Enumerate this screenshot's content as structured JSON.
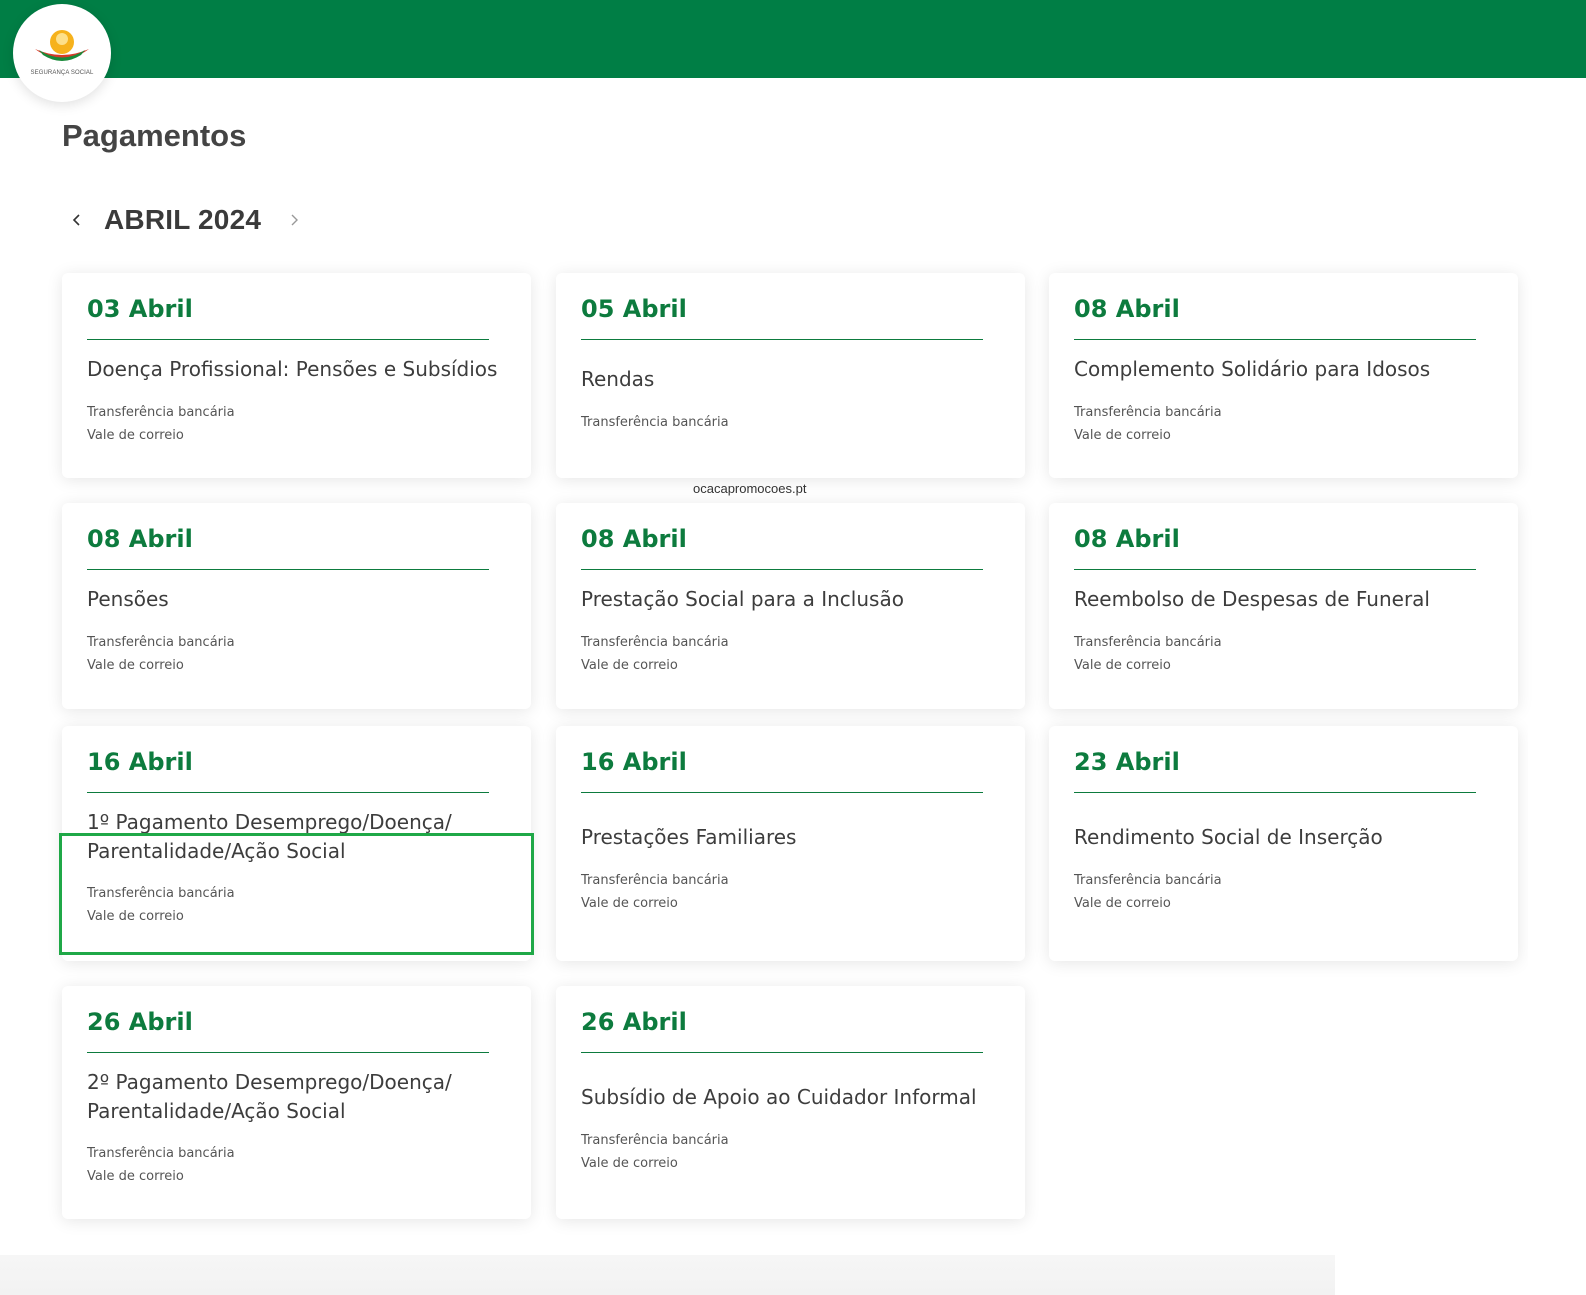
{
  "header": {
    "logo_text": "SEGURANÇA SOCIAL",
    "brand_color": "#007e45"
  },
  "page": {
    "title": "Pagamentos"
  },
  "month_nav": {
    "label": "ABRIL 2024",
    "prev_icon": "chevron-left-icon",
    "next_icon": "chevron-right-icon"
  },
  "watermark": "ocacapromocoes.pt",
  "payments": [
    {
      "date": "03 Abril",
      "title": "Doença Profissional: Pensões e Subsídios",
      "methods": [
        "Transferência bancária",
        "Vale de correio"
      ]
    },
    {
      "date": "05 Abril",
      "title": "Rendas",
      "methods": [
        "Transferência bancária"
      ]
    },
    {
      "date": "08 Abril",
      "title": "Complemento Solidário para Idosos",
      "methods": [
        "Transferência bancária",
        "Vale de correio"
      ]
    },
    {
      "date": "08 Abril",
      "title": "Pensões",
      "methods": [
        "Transferência bancária",
        "Vale de correio"
      ]
    },
    {
      "date": "08 Abril",
      "title": "Prestação Social para a Inclusão",
      "methods": [
        "Transferência bancária",
        "Vale de correio"
      ]
    },
    {
      "date": "08 Abril",
      "title": "Reembolso de Despesas de Funeral",
      "methods": [
        "Transferência bancária",
        "Vale de correio"
      ]
    },
    {
      "date": "16 Abril",
      "title": "1º Pagamento Desemprego/Doença/ Parentalidade/Ação Social",
      "methods": [
        "Transferência bancária",
        "Vale de correio"
      ]
    },
    {
      "date": "16 Abril",
      "title": "Prestações Familiares",
      "methods": [
        "Transferência bancária",
        "Vale de correio"
      ]
    },
    {
      "date": "23 Abril",
      "title": "Rendimento Social de Inserção",
      "methods": [
        "Transferência bancária",
        "Vale de correio"
      ]
    },
    {
      "date": "26 Abril",
      "title": "2º Pagamento Desemprego/Doença/ Parentalidade/Ação Social",
      "methods": [
        "Transferência bancária",
        "Vale de correio"
      ]
    },
    {
      "date": "26 Abril",
      "title": "Subsídio de Apoio ao Cuidador Informal",
      "methods": [
        "Transferência bancária",
        "Vale de correio"
      ]
    }
  ]
}
